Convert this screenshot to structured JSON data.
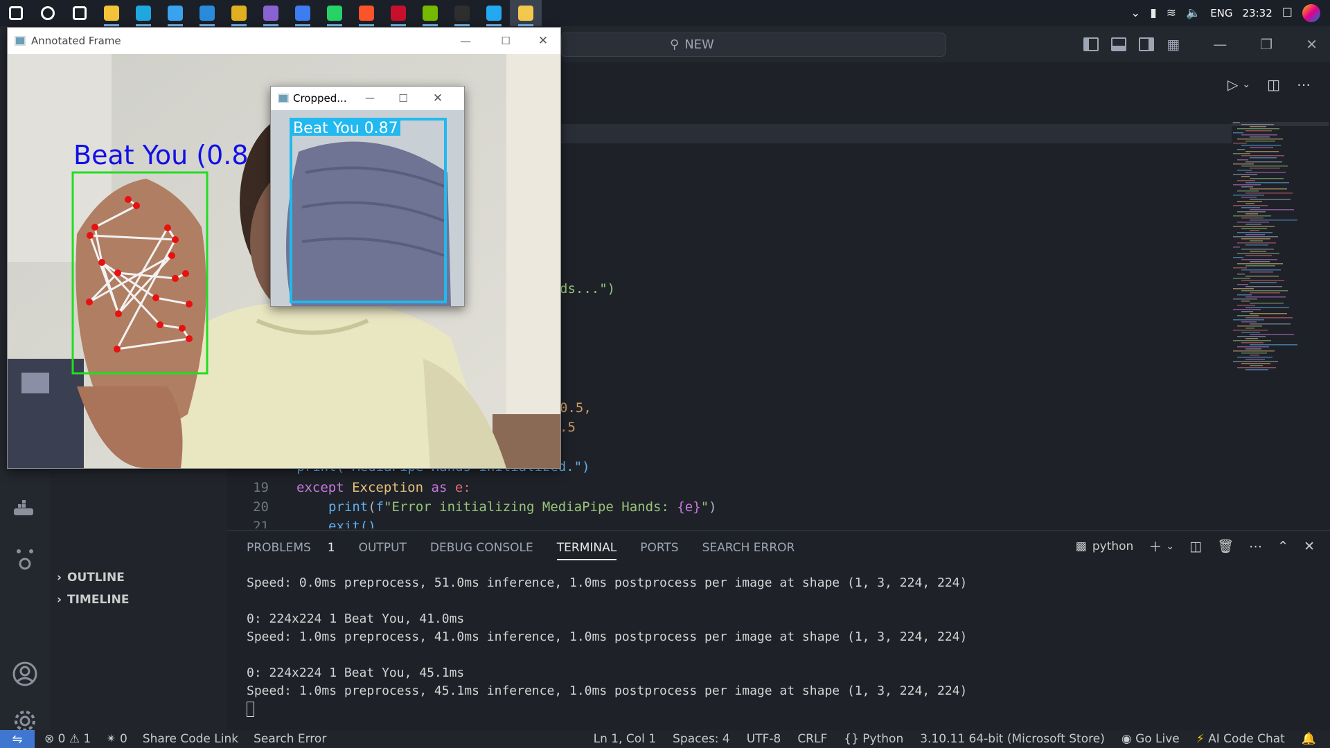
{
  "taskbar": {
    "apps": [
      {
        "name": "windows-start-icon",
        "color": "#ffffff"
      },
      {
        "name": "search-icon",
        "color": "#ffffff"
      },
      {
        "name": "task-view-icon",
        "color": "#ffffff"
      },
      {
        "name": "file-explorer-icon",
        "color": "#f3c339"
      },
      {
        "name": "edge-icon",
        "color": "#1fa7e0"
      },
      {
        "name": "store-icon",
        "color": "#3aa3ee"
      },
      {
        "name": "mail-icon",
        "color": "#2a8bdc"
      },
      {
        "name": "ampps-icon",
        "color": "#e0b020"
      },
      {
        "name": "visual-studio-icon",
        "color": "#8a63d2"
      },
      {
        "name": "medal-app-icon",
        "color": "#3d7df0"
      },
      {
        "name": "whatsapp-icon",
        "color": "#25d366"
      },
      {
        "name": "brave-icon",
        "color": "#fb542b"
      },
      {
        "name": "red-app-icon",
        "color": "#c8102e"
      },
      {
        "name": "nvidia-icon",
        "color": "#76b900"
      },
      {
        "name": "terminal-icon",
        "color": "#2e2e2e"
      },
      {
        "name": "vscode-icon",
        "color": "#23a9f2"
      },
      {
        "name": "python-icon",
        "color": "#f2c94c"
      }
    ],
    "language": "ENG",
    "time": "23:32"
  },
  "vscode": {
    "search_text": "NEW",
    "activity_icons": [
      "docker-icon",
      "ai-assistant-icon",
      "account-icon",
      "settings-gear-icon"
    ],
    "sidebar_sections": [
      "OUTLINE",
      "TIMELINE"
    ],
    "code_fragments": {
      "f1": "ds...\")",
      "f2": "0.5,",
      "f3": ".5",
      "f4": "   print(\"MediaPipe Hands initialized.\")"
    },
    "lines": [
      {
        "num": "19",
        "kw1": "except",
        "cls": "Exception",
        "kw2": "as",
        "var": "e:"
      },
      {
        "num": "20",
        "fn": "print",
        "open": "(",
        "fprefix": "f",
        "str": "\"Error initializing MediaPipe Hands: ",
        "brace": "{e}",
        "strend": "\"",
        "close": ")"
      },
      {
        "num": "21",
        "text": "exit()"
      }
    ]
  },
  "panel": {
    "tabs": [
      {
        "label": "PROBLEMS",
        "badge": "1"
      },
      {
        "label": "OUTPUT"
      },
      {
        "label": "DEBUG CONSOLE"
      },
      {
        "label": "TERMINAL",
        "active": true
      },
      {
        "label": "PORTS"
      },
      {
        "label": "SEARCH ERROR"
      }
    ],
    "terminal_name": "python",
    "terminal_lines": [
      "Speed: 0.0ms preprocess, 51.0ms inference, 1.0ms postprocess per image at shape (1, 3, 224, 224)",
      "",
      "0: 224x224 1 Beat You, 41.0ms",
      "Speed: 1.0ms preprocess, 41.0ms inference, 1.0ms postprocess per image at shape (1, 3, 224, 224)",
      "",
      "0: 224x224 1 Beat You, 45.1ms",
      "Speed: 1.0ms preprocess, 45.1ms inference, 1.0ms postprocess per image at shape (1, 3, 224, 224)"
    ]
  },
  "statusbar": {
    "errors": "0",
    "warnings": "1",
    "ports": "0",
    "left_items": [
      "Share Code Link",
      "Search Error"
    ],
    "right_items": [
      "Ln 1, Col 1",
      "Spaces: 4",
      "UTF-8",
      "CRLF",
      "{} Python",
      "3.10.11 64-bit (Microsoft Store)",
      "Go Live",
      "AI Code Chat"
    ]
  },
  "annotated_window": {
    "title": "Annotated Frame",
    "overlay_label": "Beat You (0.8",
    "box_color": "#22dd22",
    "label_color": "#1010e8"
  },
  "cropped_window": {
    "title": "Cropped...",
    "overlay_label": "Beat You 0.87",
    "box_color": "#22b8f0"
  }
}
